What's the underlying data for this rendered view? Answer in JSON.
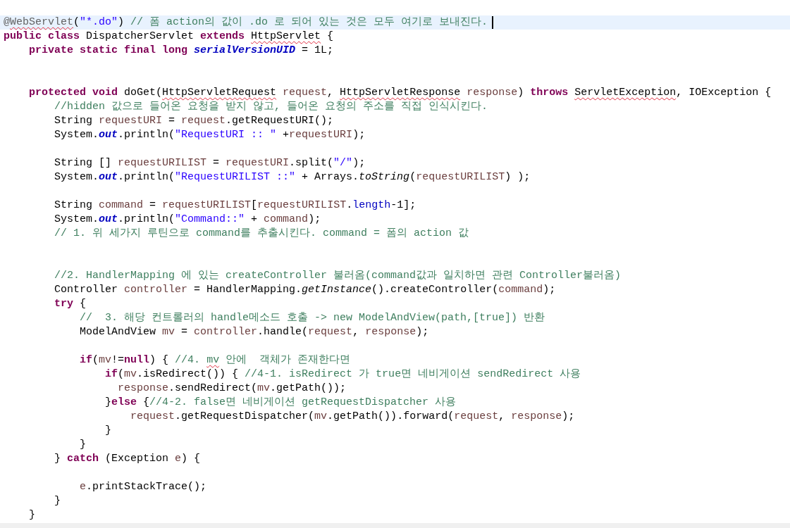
{
  "editor": {
    "lines": [
      {
        "current": true,
        "tokens": [
          {
            "text": "@",
            "kind": "annotation"
          },
          {
            "text": "WebServlet",
            "kind": "annotation",
            "misspelled": true
          },
          {
            "text": "(",
            "kind": "plain"
          },
          {
            "text": "\"*.do\"",
            "kind": "string"
          },
          {
            "text": ") ",
            "kind": "plain"
          },
          {
            "text": "// 폼 action의 값이 .do 로 되어 있는 것은 모두 여기로 보내진다.",
            "kind": "comment"
          }
        ]
      },
      {
        "current": false,
        "tokens": [
          {
            "text": "public class",
            "kind": "keyword"
          },
          {
            "text": " DispatcherServlet ",
            "kind": "plain"
          },
          {
            "text": "extends ",
            "kind": "keyword"
          },
          {
            "text": "HttpServlet",
            "kind": "plain",
            "misspelled": true
          },
          {
            "text": " {",
            "kind": "plain"
          }
        ]
      },
      {
        "current": false,
        "tokens": [
          {
            "text": "    private static final long ",
            "kind": "keyword"
          },
          {
            "text": "serialVersionUID",
            "kind": "constant"
          },
          {
            "text": " = 1L;",
            "kind": "plain"
          }
        ]
      },
      {
        "current": false
      },
      {
        "current": false
      },
      {
        "current": false,
        "tokens": [
          {
            "text": "    protected void",
            "kind": "keyword"
          },
          {
            "text": " doGet(",
            "kind": "plain"
          },
          {
            "text": "HttpServletRequest",
            "kind": "plain",
            "misspelled": true
          },
          {
            "text": " request",
            "kind": "variable"
          },
          {
            "text": ", ",
            "kind": "plain"
          },
          {
            "text": "HttpServletResponse",
            "kind": "plain",
            "misspelled": true
          },
          {
            "text": " response",
            "kind": "variable"
          },
          {
            "text": ") ",
            "kind": "plain"
          },
          {
            "text": "throws ",
            "kind": "keyword"
          },
          {
            "text": "ServletException",
            "kind": "plain",
            "misspelled": true
          },
          {
            "text": ", IOException {",
            "kind": "plain"
          }
        ]
      },
      {
        "current": false,
        "tokens": [
          {
            "text": "        //hidden 값으로 들어온 요청을 받지 않고, 들어온 요청의 주소를 직접 인식시킨다.",
            "kind": "comment"
          }
        ]
      },
      {
        "current": false,
        "tokens": [
          {
            "text": "        String ",
            "kind": "plain"
          },
          {
            "text": "requestURI",
            "kind": "variable"
          },
          {
            "text": " = ",
            "kind": "plain"
          },
          {
            "text": "request",
            "kind": "variable"
          },
          {
            "text": ".getRequestURI();",
            "kind": "plain"
          }
        ]
      },
      {
        "current": false,
        "tokens": [
          {
            "text": "        System.",
            "kind": "plain"
          },
          {
            "text": "out",
            "kind": "field"
          },
          {
            "text": ".println(",
            "kind": "plain"
          },
          {
            "text": "\"RequestURI :: \"",
            "kind": "string"
          },
          {
            "text": " +",
            "kind": "plain"
          },
          {
            "text": "requestURI",
            "kind": "variable"
          },
          {
            "text": ");",
            "kind": "plain"
          }
        ]
      },
      {
        "current": false
      },
      {
        "current": false,
        "tokens": [
          {
            "text": "        String [] ",
            "kind": "plain"
          },
          {
            "text": "requestURILIST",
            "kind": "variable"
          },
          {
            "text": " = ",
            "kind": "plain"
          },
          {
            "text": "requestURI",
            "kind": "variable"
          },
          {
            "text": ".split(",
            "kind": "plain"
          },
          {
            "text": "\"/\"",
            "kind": "string"
          },
          {
            "text": ");",
            "kind": "plain"
          }
        ]
      },
      {
        "current": false,
        "tokens": [
          {
            "text": "        System.",
            "kind": "plain"
          },
          {
            "text": "out",
            "kind": "field"
          },
          {
            "text": ".println(",
            "kind": "plain"
          },
          {
            "text": "\"RequestURILIST ::\"",
            "kind": "string"
          },
          {
            "text": " + Arrays.",
            "kind": "plain"
          },
          {
            "text": "toString",
            "kind": "static"
          },
          {
            "text": "(",
            "kind": "plain"
          },
          {
            "text": "requestURILIST",
            "kind": "variable"
          },
          {
            "text": ") );",
            "kind": "plain"
          }
        ]
      },
      {
        "current": false
      },
      {
        "current": false,
        "tokens": [
          {
            "text": "        String ",
            "kind": "plain"
          },
          {
            "text": "command",
            "kind": "variable"
          },
          {
            "text": " = ",
            "kind": "plain"
          },
          {
            "text": "requestURILIST",
            "kind": "variable"
          },
          {
            "text": "[",
            "kind": "plain"
          },
          {
            "text": "requestURILIST",
            "kind": "variable"
          },
          {
            "text": ".",
            "kind": "plain"
          },
          {
            "text": "length",
            "kind": "member"
          },
          {
            "text": "-1];",
            "kind": "plain"
          }
        ]
      },
      {
        "current": false,
        "tokens": [
          {
            "text": "        System.",
            "kind": "plain"
          },
          {
            "text": "out",
            "kind": "field"
          },
          {
            "text": ".println(",
            "kind": "plain"
          },
          {
            "text": "\"Command::\"",
            "kind": "string"
          },
          {
            "text": " + ",
            "kind": "plain"
          },
          {
            "text": "command",
            "kind": "variable"
          },
          {
            "text": ");",
            "kind": "plain"
          }
        ]
      },
      {
        "current": false,
        "tokens": [
          {
            "text": "        // 1. 위 세가지 루틴으로 command를 추출시킨다. command = 폼의 action 값",
            "kind": "comment"
          }
        ]
      },
      {
        "current": false
      },
      {
        "current": false
      },
      {
        "current": false,
        "tokens": [
          {
            "text": "        //2. HandlerMapping 에 있는 createController 불러옴(command값과 일치하면 관련 Controller불러옴)",
            "kind": "comment"
          }
        ]
      },
      {
        "current": false,
        "tokens": [
          {
            "text": "        Controller ",
            "kind": "plain"
          },
          {
            "text": "controller",
            "kind": "variable"
          },
          {
            "text": " = HandlerMapping.",
            "kind": "plain"
          },
          {
            "text": "getInstance",
            "kind": "static"
          },
          {
            "text": "().createController(",
            "kind": "plain"
          },
          {
            "text": "command",
            "kind": "variable"
          },
          {
            "text": ");",
            "kind": "plain"
          }
        ]
      },
      {
        "current": false,
        "tokens": [
          {
            "text": "        try",
            "kind": "keyword"
          },
          {
            "text": " {",
            "kind": "plain"
          }
        ]
      },
      {
        "current": false,
        "tokens": [
          {
            "text": "            //  3. 해당 컨트롤러의 handle메소드 호출 -> new ModelAndView(path,[true]) 반환",
            "kind": "comment"
          }
        ]
      },
      {
        "current": false,
        "tokens": [
          {
            "text": "            ModelAndView ",
            "kind": "plain"
          },
          {
            "text": "mv",
            "kind": "variable"
          },
          {
            "text": " = ",
            "kind": "plain"
          },
          {
            "text": "controller",
            "kind": "variable"
          },
          {
            "text": ".handle(",
            "kind": "plain"
          },
          {
            "text": "request",
            "kind": "variable"
          },
          {
            "text": ", ",
            "kind": "plain"
          },
          {
            "text": "response",
            "kind": "variable"
          },
          {
            "text": ");",
            "kind": "plain"
          }
        ]
      },
      {
        "current": false
      },
      {
        "current": false,
        "tokens": [
          {
            "text": "            if",
            "kind": "keyword"
          },
          {
            "text": "(",
            "kind": "plain"
          },
          {
            "text": "mv",
            "kind": "variable"
          },
          {
            "text": "!=",
            "kind": "plain"
          },
          {
            "text": "null",
            "kind": "keyword"
          },
          {
            "text": ") { ",
            "kind": "plain"
          },
          {
            "text": "//4. ",
            "kind": "comment"
          },
          {
            "text": "mv",
            "kind": "comment",
            "misspelled": true
          },
          {
            "text": " 안에  객체가 존재한다면",
            "kind": "comment"
          }
        ]
      },
      {
        "current": false,
        "tokens": [
          {
            "text": "                if",
            "kind": "keyword"
          },
          {
            "text": "(",
            "kind": "plain"
          },
          {
            "text": "mv",
            "kind": "variable"
          },
          {
            "text": ".isRedirect()) { ",
            "kind": "plain"
          },
          {
            "text": "//4-1. isRedirect 가 true면 네비게이션 sendRedirect 사용",
            "kind": "comment"
          }
        ]
      },
      {
        "current": false,
        "tokens": [
          {
            "text": "                  response",
            "kind": "variable"
          },
          {
            "text": ".sendRedirect(",
            "kind": "plain"
          },
          {
            "text": "mv",
            "kind": "variable"
          },
          {
            "text": ".getPath());",
            "kind": "plain"
          }
        ]
      },
      {
        "current": false,
        "tokens": [
          {
            "text": "                }",
            "kind": "plain"
          },
          {
            "text": "else",
            "kind": "keyword"
          },
          {
            "text": " {",
            "kind": "plain"
          },
          {
            "text": "//4-2. false면 네비게이션 getRequestDispatcher 사용",
            "kind": "comment"
          }
        ]
      },
      {
        "current": false,
        "tokens": [
          {
            "text": "                    request",
            "kind": "variable"
          },
          {
            "text": ".getRequestDispatcher(",
            "kind": "plain"
          },
          {
            "text": "mv",
            "kind": "variable"
          },
          {
            "text": ".getPath()).forward(",
            "kind": "plain"
          },
          {
            "text": "request",
            "kind": "variable"
          },
          {
            "text": ", ",
            "kind": "plain"
          },
          {
            "text": "response",
            "kind": "variable"
          },
          {
            "text": ");",
            "kind": "plain"
          }
        ]
      },
      {
        "current": false,
        "tokens": [
          {
            "text": "                }",
            "kind": "plain"
          }
        ]
      },
      {
        "current": false,
        "tokens": [
          {
            "text": "            }",
            "kind": "plain"
          }
        ]
      },
      {
        "current": false,
        "tokens": [
          {
            "text": "        } ",
            "kind": "plain"
          },
          {
            "text": "catch",
            "kind": "keyword"
          },
          {
            "text": " (Exception ",
            "kind": "plain"
          },
          {
            "text": "e",
            "kind": "variable"
          },
          {
            "text": ") {",
            "kind": "plain"
          }
        ]
      },
      {
        "current": false
      },
      {
        "current": false,
        "tokens": [
          {
            "text": "            e",
            "kind": "variable"
          },
          {
            "text": ".printStackTrace();",
            "kind": "plain"
          }
        ]
      },
      {
        "current": false,
        "tokens": [
          {
            "text": "        }",
            "kind": "plain"
          }
        ]
      },
      {
        "current": false,
        "tokens": [
          {
            "text": "    }",
            "kind": "plain"
          }
        ]
      }
    ]
  }
}
